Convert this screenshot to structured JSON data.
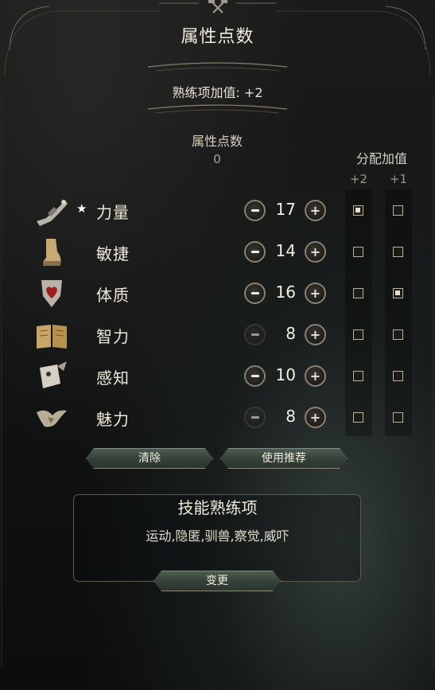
{
  "title": "属性点数",
  "proficiency_bonus": "熟练项加值: +2",
  "points": {
    "label": "属性点数",
    "value": "0"
  },
  "allocation": {
    "label": "分配加值",
    "col_a": "+2",
    "col_b": "+1"
  },
  "stats": [
    {
      "name": "力量",
      "value": "17",
      "primary": true,
      "primary_mark": "★",
      "icon": "gauntlet-icon",
      "minus_enabled": true,
      "plus_enabled": true,
      "plus2": true,
      "plus1": false
    },
    {
      "name": "敏捷",
      "value": "14",
      "primary": false,
      "icon": "boot-icon",
      "minus_enabled": true,
      "plus_enabled": true,
      "plus2": false,
      "plus1": false
    },
    {
      "name": "体质",
      "value": "16",
      "primary": false,
      "icon": "shield-heart-icon",
      "minus_enabled": true,
      "plus_enabled": true,
      "plus2": false,
      "plus1": true
    },
    {
      "name": "智力",
      "value": "8",
      "primary": false,
      "icon": "book-icon",
      "minus_enabled": false,
      "plus_enabled": true,
      "plus2": false,
      "plus1": false
    },
    {
      "name": "感知",
      "value": "10",
      "primary": false,
      "icon": "eye-paw-icon",
      "minus_enabled": true,
      "plus_enabled": true,
      "plus2": false,
      "plus1": false
    },
    {
      "name": "魅力",
      "value": "8",
      "primary": false,
      "icon": "bird-icon",
      "minus_enabled": false,
      "plus_enabled": true,
      "plus2": false,
      "plus1": false
    }
  ],
  "buttons": {
    "clear": "清除",
    "recommend": "使用推荐",
    "change": "变更"
  },
  "skills": {
    "title": "技能熟练项",
    "list": "运动,隐匿,驯兽,察觉,威吓"
  },
  "colors": {
    "panel_bg": "#121313",
    "text": "#efe9dc",
    "button_green": "#3b4a3f",
    "border_gold": "#8f8a76"
  }
}
